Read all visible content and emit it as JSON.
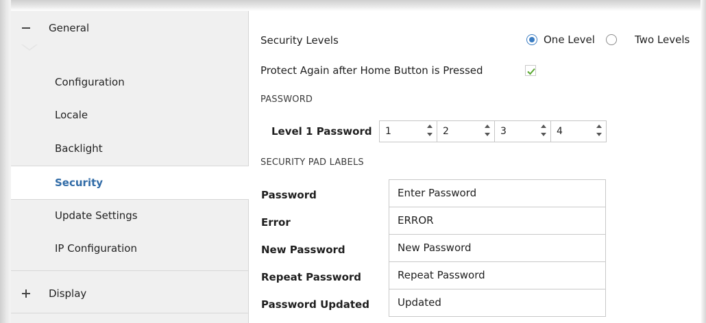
{
  "sidebar": {
    "group_general": "General",
    "items": [
      {
        "label": "Configuration"
      },
      {
        "label": "Locale"
      },
      {
        "label": "Backlight"
      },
      {
        "label": "Security"
      },
      {
        "label": "Update Settings"
      },
      {
        "label": "IP Configuration"
      }
    ],
    "selected": "Security",
    "group_display": "Display"
  },
  "main": {
    "security_levels_label": "Security Levels",
    "levels": {
      "options": [
        "One Level",
        "Two Levels"
      ],
      "selected": "One Level"
    },
    "protect_label": "Protect Again after Home Button is Pressed",
    "protect_checked": true,
    "password_section": "PASSWORD",
    "level1_label": "Level 1 Password",
    "level1_digits": [
      "1",
      "2",
      "3",
      "4"
    ],
    "pad_section": "SECURITY PAD LABELS",
    "pad_labels": [
      {
        "label": "Password",
        "value": "Enter Password"
      },
      {
        "label": "Error",
        "value": "ERROR"
      },
      {
        "label": "New Password",
        "value": "New Password"
      },
      {
        "label": "Repeat Password",
        "value": "Repeat Password"
      },
      {
        "label": "Password Updated",
        "value": "Updated"
      }
    ]
  },
  "colors": {
    "accent": "#3a7cc2",
    "selected_text": "#2f6aa6",
    "check": "#5aa832",
    "sidebar_bg": "#f0f0f0"
  }
}
